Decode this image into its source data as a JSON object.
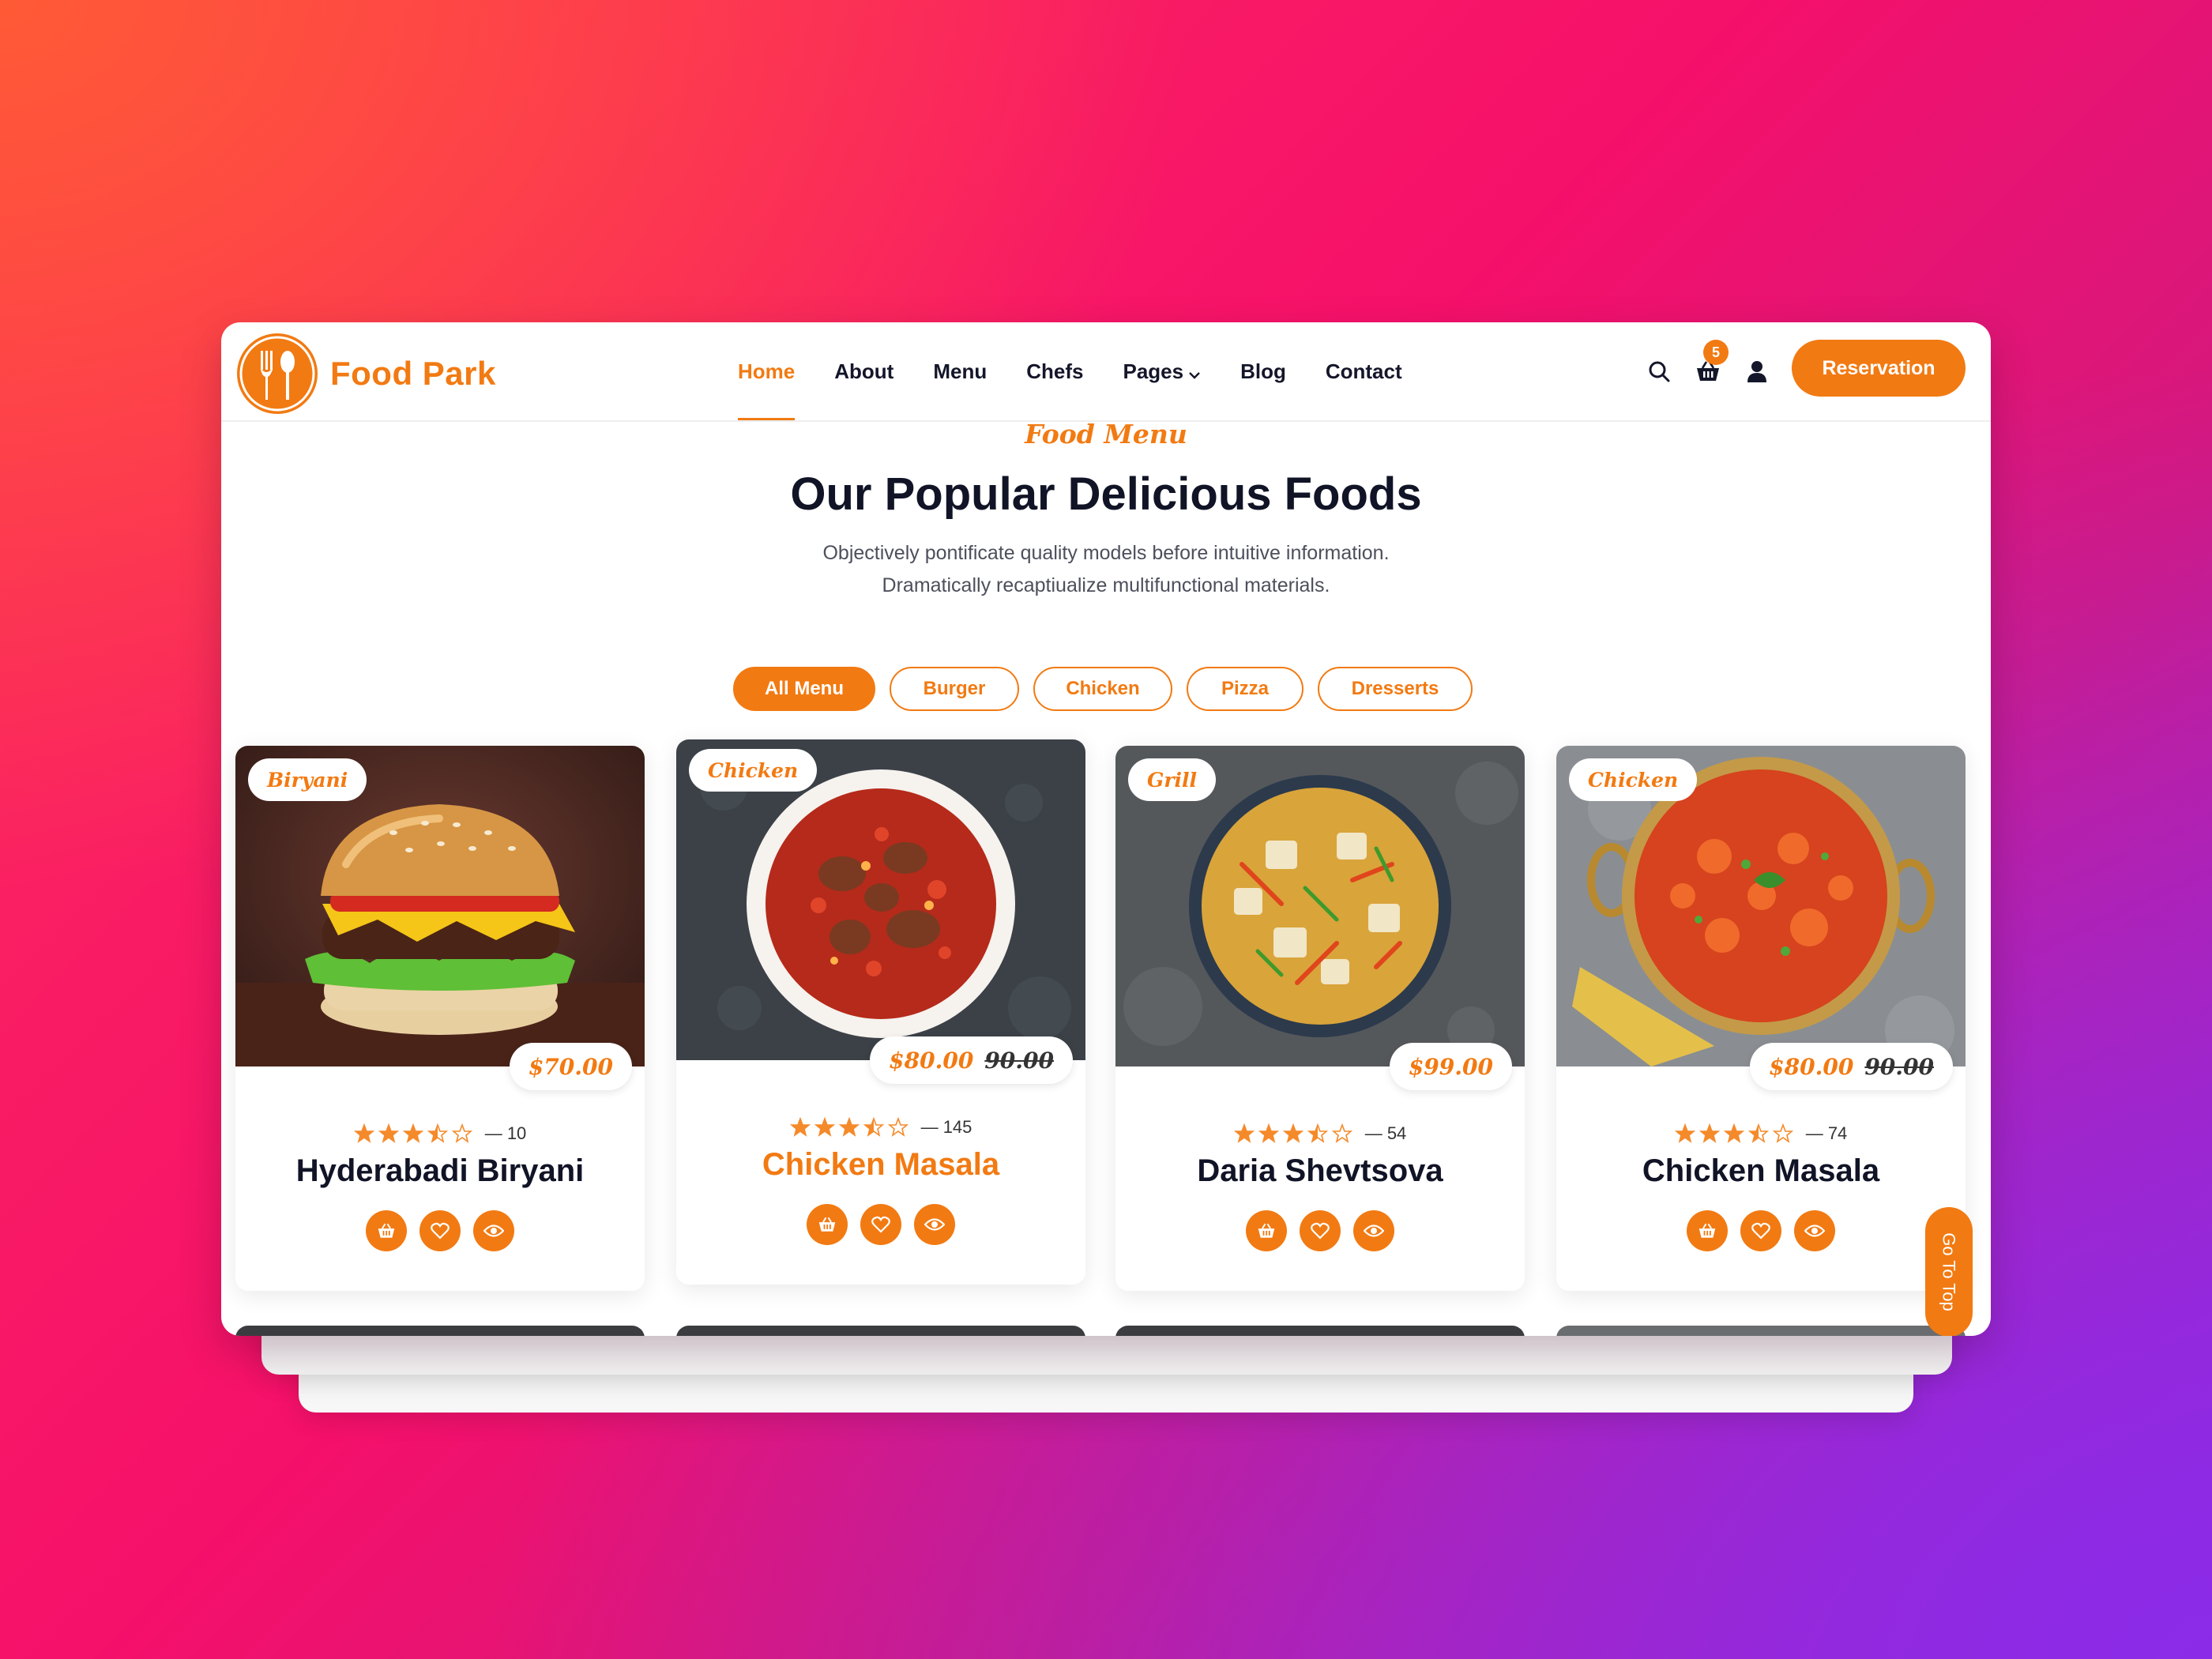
{
  "brand": {
    "name": "Food Park",
    "accent": "#f27a12"
  },
  "nav": {
    "items": [
      {
        "label": "Home",
        "active": true
      },
      {
        "label": "About"
      },
      {
        "label": "Menu"
      },
      {
        "label": "Chefs"
      },
      {
        "label": "Pages",
        "has_dropdown": true
      },
      {
        "label": "Blog"
      },
      {
        "label": "Contact"
      }
    ]
  },
  "header_tools": {
    "search_icon": "search-icon",
    "cart_icon": "basket-icon",
    "cart_count": "5",
    "user_icon": "user-icon",
    "reservation_label": "Reservation"
  },
  "section": {
    "eyebrow": "Food Menu",
    "title": "Our Popular Delicious Foods",
    "subtitle_line1": "Objectively pontificate quality models before intuitive information.",
    "subtitle_line2": "Dramatically recaptiualize multifunctional materials."
  },
  "filters": [
    "All Menu",
    "Burger",
    "Chicken",
    "Pizza",
    "Dresserts"
  ],
  "cards": [
    {
      "tag": "Biryani",
      "price": "$70.00",
      "old_price": "",
      "rating": 3.5,
      "reviews": "— 10",
      "name": "Hyderabadi Biryani",
      "highlight": false
    },
    {
      "tag": "Chicken",
      "price": "$80.00",
      "old_price": "90.00",
      "rating": 3.5,
      "reviews": "— 145",
      "name": "Chicken Masala",
      "highlight": true
    },
    {
      "tag": "Grill",
      "price": "$99.00",
      "old_price": "",
      "rating": 3.5,
      "reviews": "— 54",
      "name": "Daria Shevtsova",
      "highlight": false
    },
    {
      "tag": "Chicken",
      "price": "$80.00",
      "old_price": "90.00",
      "rating": 3.5,
      "reviews": "— 74",
      "name": "Chicken Masala",
      "highlight": false
    }
  ],
  "go_to_top": "Go To Top"
}
